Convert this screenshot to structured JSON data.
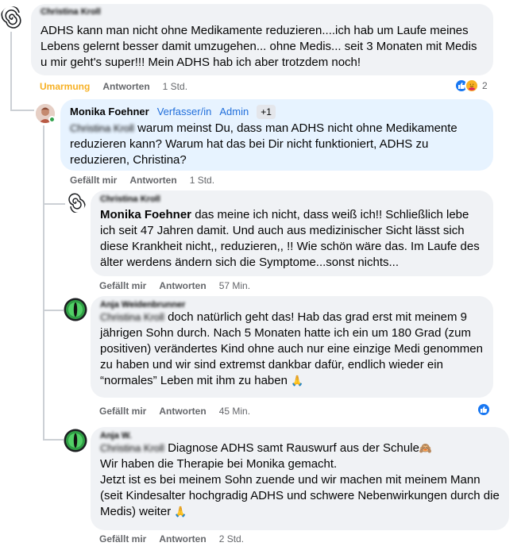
{
  "comments": [
    {
      "author_blur": "Christina Kroll",
      "text": "ADHS kann man nicht ohne Medikamente reduzieren....ich hab um Laufe meines Lebens gelernt besser damit umzugehen... ohne Medis... seit 3 Monaten mit Medis u mir geht's super!!! Mein ADHS hab ich aber trotzdem noch!",
      "reaction_label": "Umarmung",
      "reply_label": "Antworten",
      "time": "1 Std.",
      "reaction_count": "2"
    },
    {
      "author": "Monika Foehner",
      "role": "Verfasser/in",
      "admin": "Admin",
      "badge_count": "+1",
      "mention_blur": "Christina Kroll",
      "text": "warum meinst Du, dass man ADHS nicht ohne Medikamente reduzieren kann? Warum hat das bei Dir nicht funktioniert, ADHS zu reduzieren, Christina?",
      "like_label": "Gefällt mir",
      "reply_label": "Antworten",
      "time": "1 Std."
    },
    {
      "author_blur": "Christina Kroll",
      "mention": "Monika Foehner",
      "text": "das meine ich nicht, dass weiß ich!! Schließlich lebe ich seit 47 Jahren damit. Und auch aus medizinischer Sicht lässt sich diese Krankheit nicht,, reduzieren,, !! Wie schön wäre das. Im Laufe des älter werdens ändern sich die Symptome...sonst nichts...",
      "like_label": "Gefällt mir",
      "reply_label": "Antworten",
      "time": "57 Min."
    },
    {
      "author_blur": "Anja Weidenbrunner",
      "mention_blur": "Christina Kroll",
      "text": "doch natürlich geht das! Hab das grad erst mit meinem 9 jährigen Sohn durch. Nach 5 Monaten hatte ich ein um 180 Grad (zum positiven) verändertes Kind ohne auch nur eine einzige Medi genommen zu haben und wir sind extremst dankbar dafür, endlich wieder ein “normales” Leben mit ihm zu haben",
      "emoji": "🙏",
      "like_label": "Gefällt mir",
      "reply_label": "Antworten",
      "time": "45 Min."
    },
    {
      "author_blur": "Anja W.",
      "mention_blur": "Christina Kroll",
      "line1": "Diagnose ADHS samt Rauswurf aus der Schule",
      "line1_emoji": "🙈",
      "line2": "Wir haben die Therapie bei Monika gemacht.",
      "line3": "Jetzt ist es bei meinem Sohn zuende und wir machen mit meinem Mann (seit Kindesalter hochgradig ADHS und schwere Nebenwirkungen durch die Medis) weiter",
      "line3_emoji": "🙏",
      "like_label": "Gefällt mir",
      "reply_label": "Antworten",
      "time": "2 Std."
    }
  ],
  "colors": {
    "bubble": "#f0f2f5",
    "bubble_highlight": "#e7f3ff",
    "link_blue": "#216fdb",
    "hug_yellow": "#f7b125",
    "meta_gray": "#65676b"
  },
  "icons": {
    "spiral_avatar": "spiral-avatar-icon",
    "green_eye_avatar": "green-eye-avatar-icon",
    "like_reaction": "thumbs-up-icon",
    "hug_reaction": "hug-icon"
  }
}
